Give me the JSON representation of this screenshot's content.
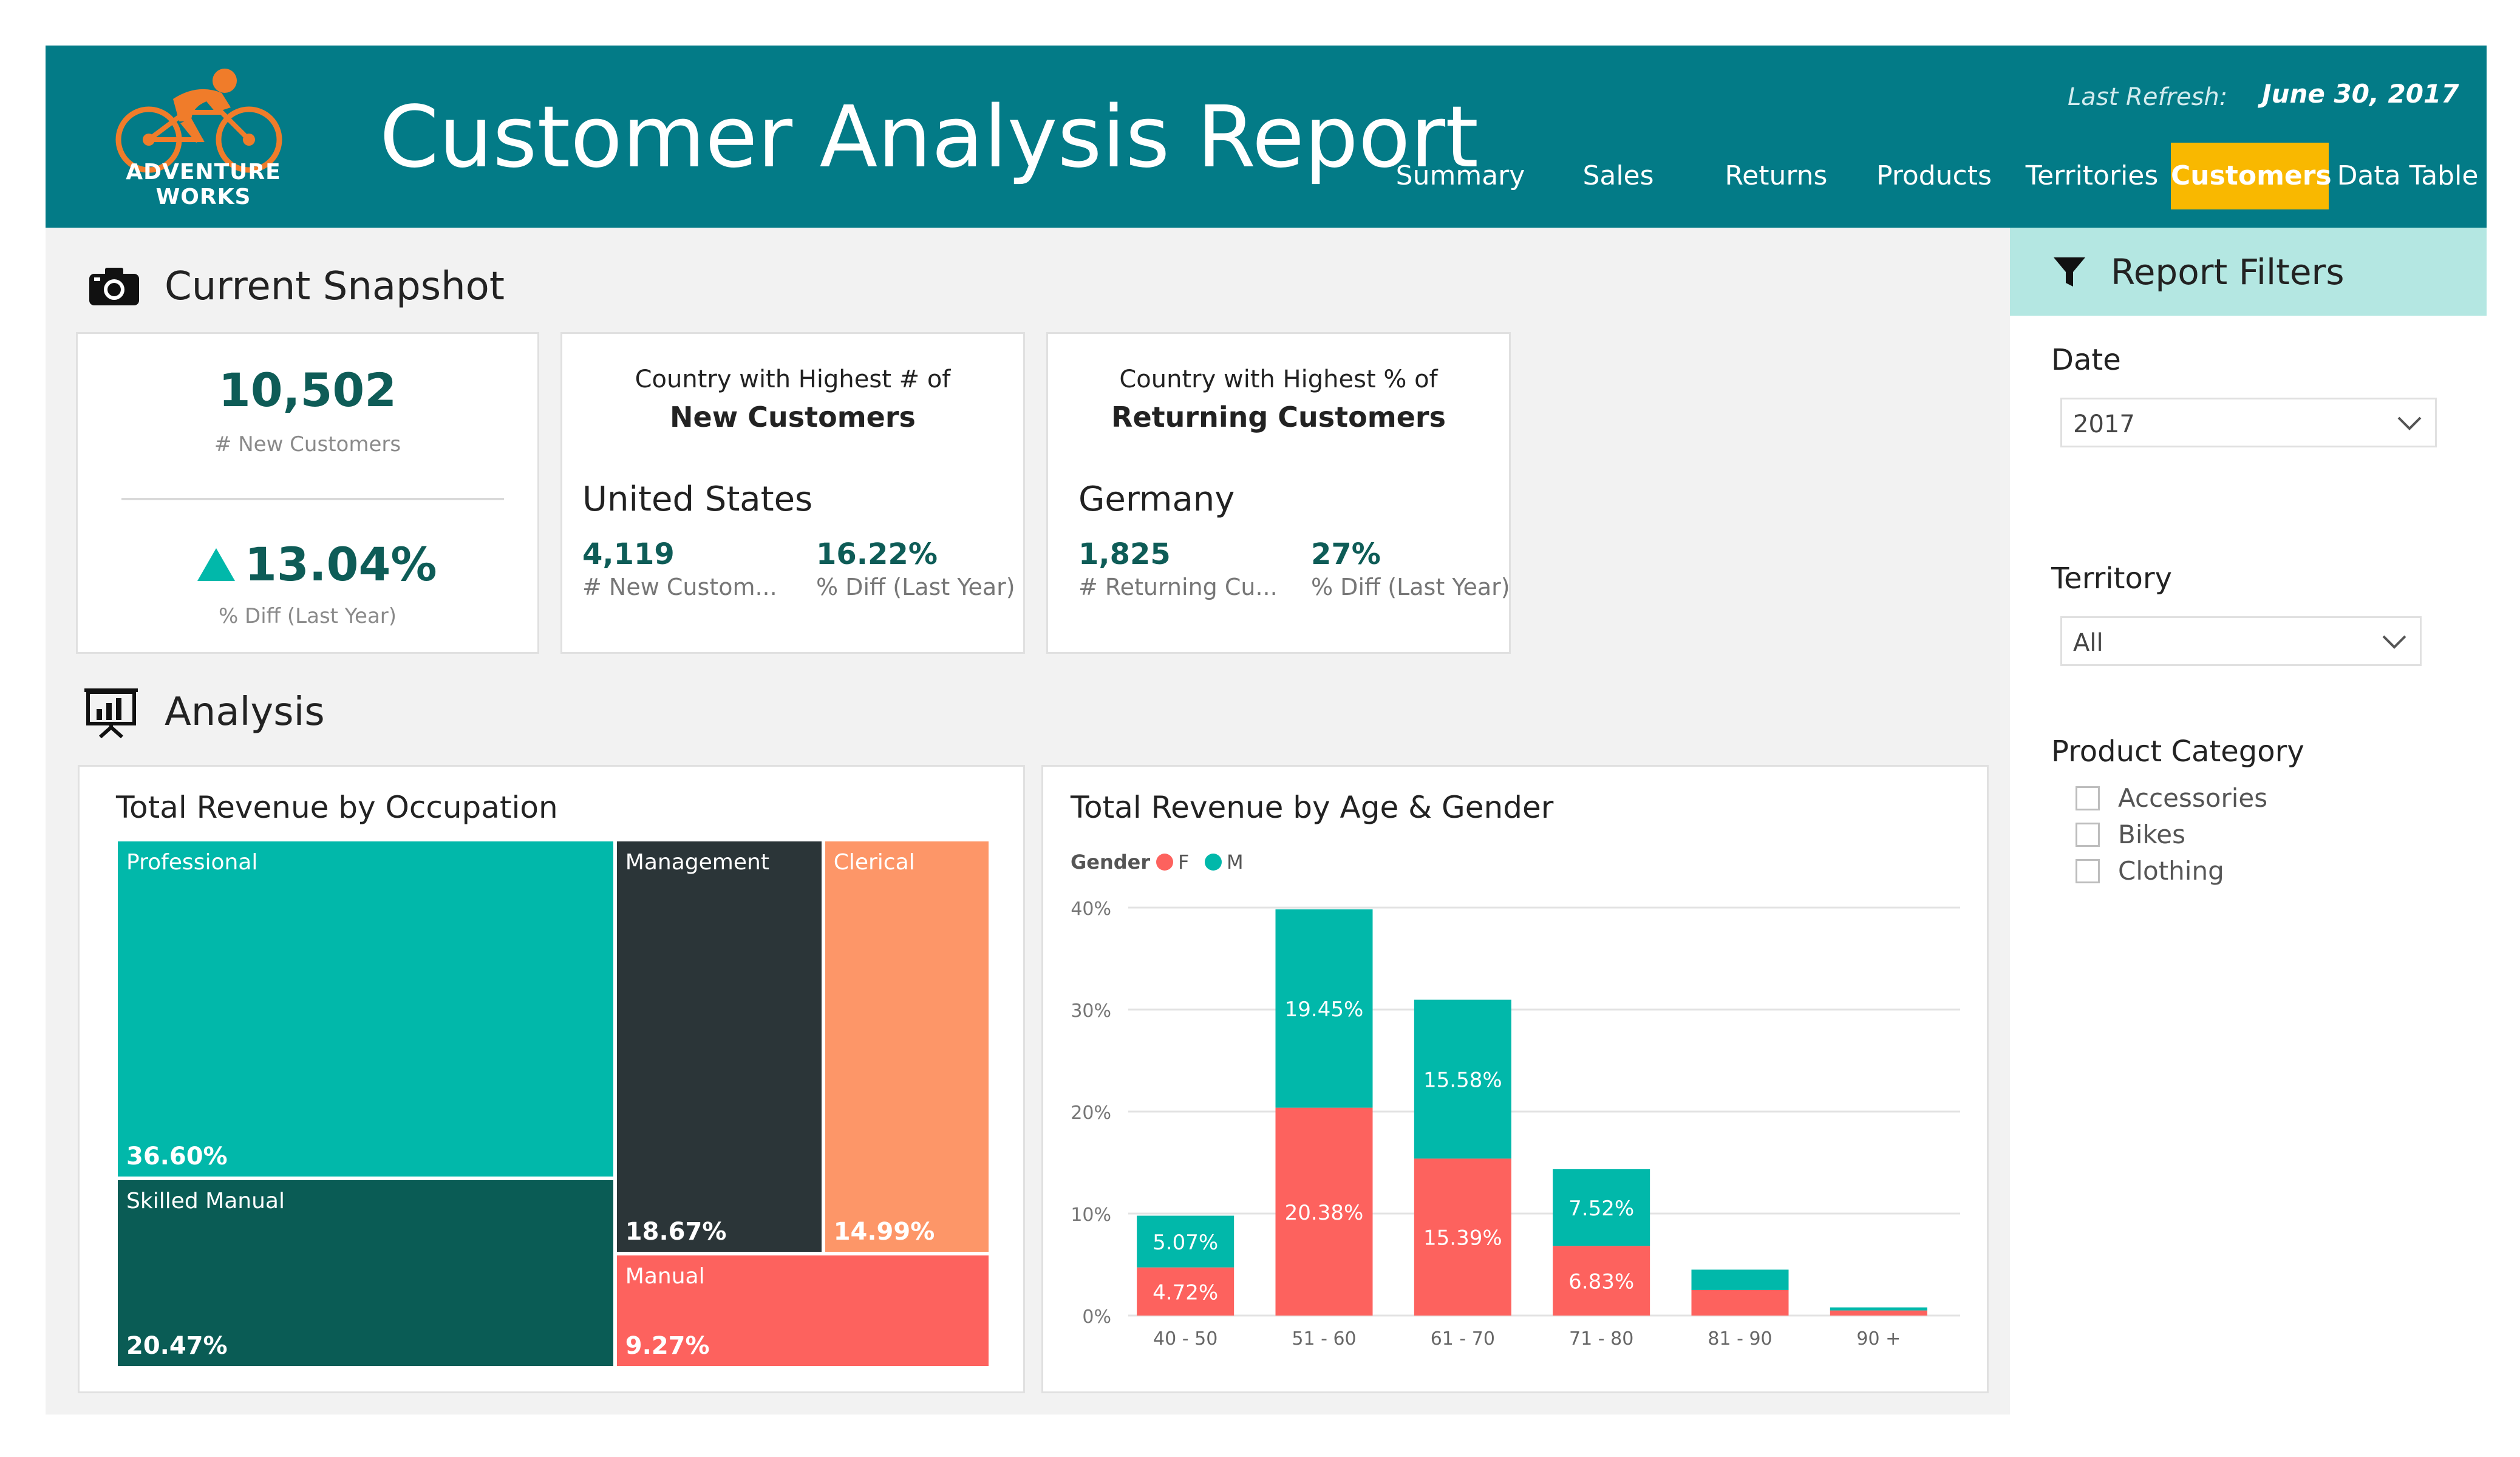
{
  "header": {
    "logo_text": "ADVENTURE WORKS",
    "title": "Customer Analysis Report",
    "refresh_label": "Last Refresh:",
    "refresh_date": "June 30, 2017",
    "colors": {
      "header_bg": "#037b87",
      "active_tab": "#f9b800"
    },
    "tabs": [
      {
        "label": "Summary",
        "active": false
      },
      {
        "label": "Sales",
        "active": false
      },
      {
        "label": "Returns",
        "active": false
      },
      {
        "label": "Products",
        "active": false
      },
      {
        "label": "Territories",
        "active": false
      },
      {
        "label": "Customers",
        "active": true
      },
      {
        "label": "Data Table",
        "active": false
      }
    ]
  },
  "snapshot": {
    "title": "Current Snapshot",
    "icon": "camera-icon",
    "kpi1": {
      "value": "10,502",
      "label": "# New Customers",
      "diff": "13.04%",
      "diff_label": "% Diff (Last Year)"
    },
    "kpi2": {
      "head1": "Country with Highest # of",
      "head2": "New Customers",
      "country": "United States",
      "value1": "4,119",
      "label1": "# New Custom...",
      "value2": "16.22%",
      "label2": "% Diff (Last Year)"
    },
    "kpi3": {
      "head1": "Country with Highest % of",
      "head2": "Returning Customers",
      "country": "Germany",
      "value1": "1,825",
      "label1": "# Returning Cu...",
      "value2": "27%",
      "label2": "% Diff (Last Year)"
    }
  },
  "analysis": {
    "title": "Analysis",
    "icon": "presentation-chart-icon"
  },
  "filters": {
    "title": "Report Filters",
    "icon": "filter-icon",
    "date": {
      "label": "Date",
      "value": "2017"
    },
    "territory": {
      "label": "Territory",
      "value": "All"
    },
    "category": {
      "label": "Product Category",
      "options": [
        "Accessories",
        "Bikes",
        "Clothing"
      ]
    }
  },
  "chart_data": [
    {
      "type": "treemap",
      "title": "Total Revenue by Occupation",
      "categories": [
        "Professional",
        "Skilled Manual",
        "Management",
        "Clerical",
        "Manual"
      ],
      "values": [
        36.6,
        20.47,
        18.67,
        14.99,
        9.27
      ],
      "labels": [
        "36.60%",
        "20.47%",
        "18.67%",
        "14.99%",
        "9.27%"
      ],
      "colors": [
        "#01b8aa",
        "#0a5c55",
        "#2b3538",
        "#fd9668",
        "#fd625e"
      ]
    },
    {
      "type": "stacked-bar",
      "title": "Total Revenue by Age & Gender",
      "legend_title": "Gender",
      "categories": [
        "40 - 50",
        "51 - 60",
        "61 - 70",
        "71 - 80",
        "81 - 90",
        "90 +"
      ],
      "series": [
        {
          "name": "F",
          "color": "#fd625e",
          "values": [
            4.72,
            20.38,
            15.39,
            6.83,
            2.5,
            0.5
          ],
          "labels": [
            "4.72%",
            "20.38%",
            "15.39%",
            "6.83%",
            "",
            ""
          ]
        },
        {
          "name": "M",
          "color": "#01b8aa",
          "values": [
            5.07,
            19.45,
            15.58,
            7.52,
            2.0,
            0.3
          ],
          "labels": [
            "5.07%",
            "19.45%",
            "15.58%",
            "7.52%",
            "",
            ""
          ]
        }
      ],
      "ylim": [
        0,
        40
      ],
      "yticks": [
        0,
        10,
        20,
        30,
        40
      ],
      "ytick_labels": [
        "0%",
        "10%",
        "20%",
        "30%",
        "40%"
      ],
      "grid": true,
      "legend": "top-left"
    }
  ]
}
